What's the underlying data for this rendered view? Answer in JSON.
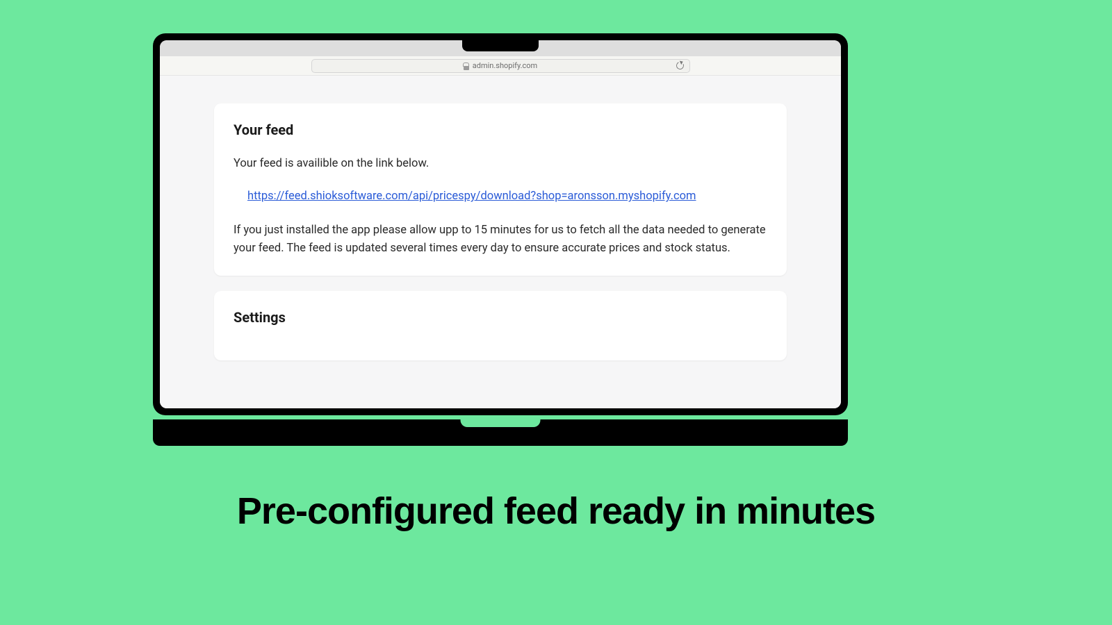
{
  "browser": {
    "url": "admin.shopify.com"
  },
  "feed_card": {
    "heading": "Your feed",
    "intro": "Your feed is availible on the link below.",
    "link": "https://feed.shioksoftware.com/api/pricespy/download?shop=aronsson.myshopify.com",
    "info": "If you just installed the app please allow upp to 15 minutes for us to fetch all the data needed to generate your feed. The feed is updated several times every day to ensure accurate prices and stock status."
  },
  "settings_card": {
    "heading": "Settings"
  },
  "headline": "Pre-configured feed ready in minutes"
}
